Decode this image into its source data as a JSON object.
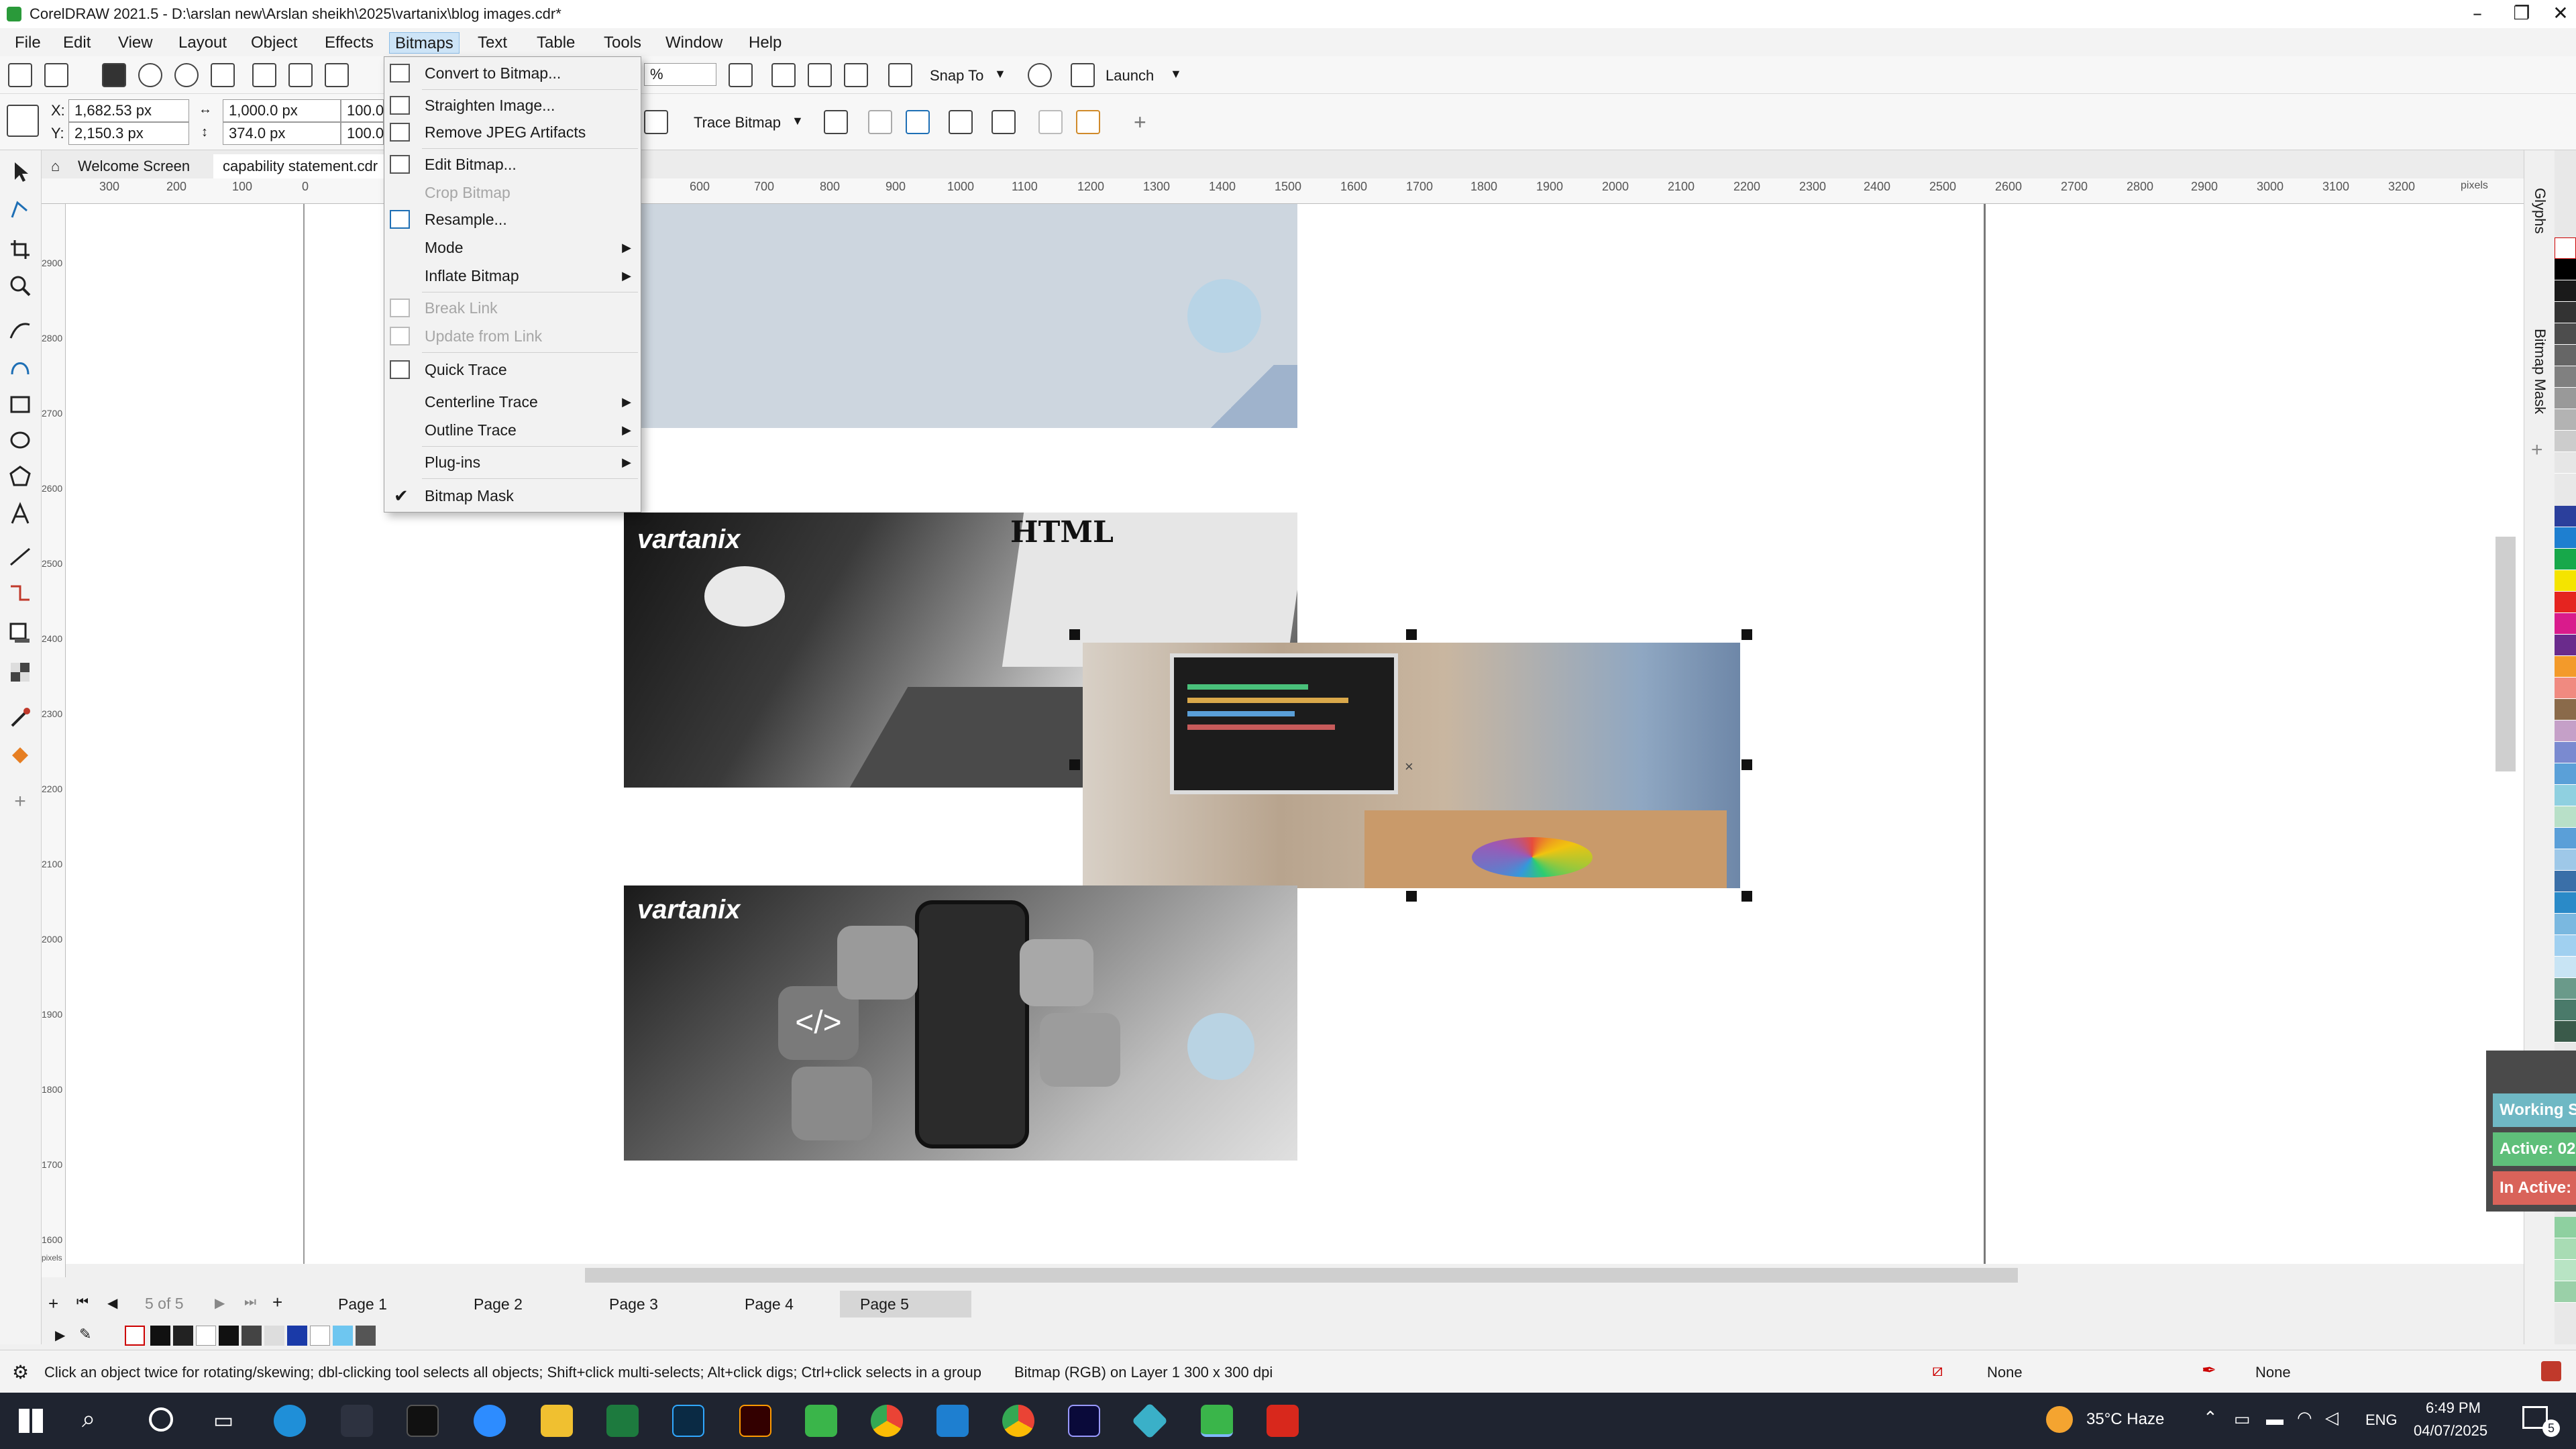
{
  "window": {
    "title": "CorelDRAW 2021.5 - D:\\arslan new\\Arslan sheikh\\2025\\vartanix\\blog images.cdr*",
    "controls": [
      "–",
      "❐",
      "✕"
    ]
  },
  "menubar": {
    "items": [
      "File",
      "Edit",
      "View",
      "Layout",
      "Object",
      "Effects",
      "Bitmaps",
      "Text",
      "Table",
      "Tools",
      "Window",
      "Help"
    ],
    "active": "Bitmaps"
  },
  "toolbar": {
    "zoom_value": "%",
    "snap_to": "Snap To",
    "launch": "Launch"
  },
  "property_bar": {
    "x_label": "X:",
    "x_value": "1,682.53 px",
    "y_label": "Y:",
    "y_value": "2,150.3 px",
    "width_value": "1,000.0 px",
    "height_value": "374.0 px",
    "scale_x": "100.0",
    "scale_y": "100.0",
    "trace_bitmap": "Trace Bitmap"
  },
  "doc_tabs": {
    "welcome": "Welcome Screen",
    "file": "capability statement.cdr"
  },
  "ruler": {
    "h_ticks": [
      "300",
      "200",
      "100",
      "0",
      "600",
      "700",
      "800",
      "900",
      "1000",
      "1100",
      "1200",
      "1300",
      "1400",
      "1500",
      "1600",
      "1700",
      "1800",
      "1900",
      "2000",
      "2100",
      "2200",
      "2300",
      "2400",
      "2500",
      "2600",
      "2700",
      "2800",
      "2900",
      "3000",
      "3100",
      "3200"
    ],
    "unit": "pixels",
    "v_ticks": [
      "2900",
      "2800",
      "2700",
      "2600",
      "2500",
      "2400",
      "2300",
      "2200",
      "2100",
      "2000",
      "1900",
      "1800",
      "1700",
      "1600"
    ],
    "v_unit": "pixels"
  },
  "bitmaps_menu": {
    "items": [
      {
        "label": "Convert to Bitmap...",
        "disabled": false,
        "submenu": false
      },
      {
        "label": "Straighten Image...",
        "disabled": false,
        "submenu": false
      },
      {
        "label": "Remove JPEG Artifacts",
        "disabled": false,
        "submenu": false
      },
      {
        "label": "Edit Bitmap...",
        "disabled": false,
        "submenu": false
      },
      {
        "label": "Crop Bitmap",
        "disabled": true,
        "submenu": false
      },
      {
        "label": "Resample...",
        "disabled": false,
        "submenu": false
      },
      {
        "label": "Mode",
        "disabled": false,
        "submenu": true
      },
      {
        "label": "Inflate Bitmap",
        "disabled": false,
        "submenu": true
      },
      {
        "label": "Break Link",
        "disabled": true,
        "submenu": false
      },
      {
        "label": "Update from Link",
        "disabled": true,
        "submenu": false
      },
      {
        "label": "Quick Trace",
        "disabled": false,
        "submenu": false
      },
      {
        "label": "Centerline Trace",
        "disabled": false,
        "submenu": true
      },
      {
        "label": "Outline Trace",
        "disabled": false,
        "submenu": true
      },
      {
        "label": "Plug-ins",
        "disabled": false,
        "submenu": true
      },
      {
        "label": "Bitmap Mask",
        "disabled": false,
        "submenu": false,
        "checked": true
      }
    ]
  },
  "canvas": {
    "brand_top": "vartanix",
    "brand_bottom": "vartanix",
    "html_label": "HTML"
  },
  "docker": {
    "glyphs": "Glyphs",
    "bitmap_mask": "Bitmap Mask"
  },
  "page_nav": {
    "counter": "5 of 5",
    "pages": [
      "Page 1",
      "Page 2",
      "Page 3",
      "Page 4",
      "Page 5"
    ],
    "active": "Page 5"
  },
  "statusbar": {
    "hint": "Click an object twice for rotating/skewing; dbl-clicking tool selects all objects; Shift+click multi-selects; Alt+click digs; Ctrl+click selects in a group",
    "object_info": "Bitmap (RGB) on Layer 1 300 x 300 dpi",
    "fill": "None",
    "outline": "None"
  },
  "notifications": {
    "working": "Working S",
    "active": "Active: 02",
    "inactive": "In Active:"
  },
  "taskbar": {
    "weather": "35°C  Haze",
    "language": "ENG",
    "time": "6:49 PM",
    "date": "04/07/2025",
    "badge": "5",
    "apps": [
      "start",
      "search",
      "cortana",
      "task-view",
      "edge",
      "wacom",
      "terminal",
      "zoom",
      "explorer",
      "excel",
      "photoshop",
      "illustrator",
      "coreldraw",
      "chrome",
      "vscode",
      "chrome-profile",
      "premiere",
      "app-diamond",
      "coreldraw-active",
      "acrobat"
    ]
  },
  "colors": {
    "menu_active": "#cde4f7",
    "selection": "#111111",
    "note_working": "#6fb8c4",
    "note_active": "#5fbf7a",
    "note_inactive": "#d9635a"
  }
}
